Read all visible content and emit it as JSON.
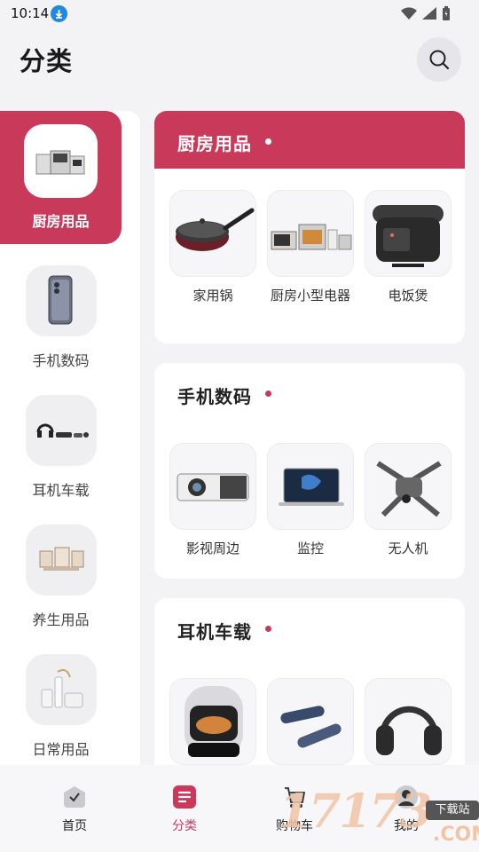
{
  "status_bar": {
    "time": "10:14"
  },
  "header": {
    "title": "分类"
  },
  "categories": [
    {
      "label": "厨房用品",
      "active": true
    },
    {
      "label": "手机数码",
      "active": false
    },
    {
      "label": "耳机车载",
      "active": false
    },
    {
      "label": "养生用品",
      "active": false
    },
    {
      "label": "日常用品",
      "active": false
    }
  ],
  "sections": [
    {
      "title": "厨房用品",
      "products": [
        {
          "label": "家用锅"
        },
        {
          "label": "厨房小型电器"
        },
        {
          "label": "电饭煲"
        }
      ]
    },
    {
      "title": "手机数码",
      "products": [
        {
          "label": "影视周边"
        },
        {
          "label": "监控"
        },
        {
          "label": "无人机"
        }
      ]
    },
    {
      "title": "耳机车载",
      "products": [
        {
          "label": ""
        },
        {
          "label": ""
        },
        {
          "label": ""
        }
      ]
    }
  ],
  "bottom_nav": [
    {
      "label": "首页",
      "icon": "home-icon"
    },
    {
      "label": "分类",
      "icon": "category-icon",
      "active": true
    },
    {
      "label": "购物车",
      "icon": "cart-icon"
    },
    {
      "label": "我的",
      "icon": "profile-icon"
    }
  ],
  "watermark": {
    "text": "17173",
    "badge": "下载站",
    "suffix": ".COM"
  },
  "colors": {
    "accent": "#c8395a",
    "background": "#f3f3f6",
    "panel": "#ffffff"
  }
}
